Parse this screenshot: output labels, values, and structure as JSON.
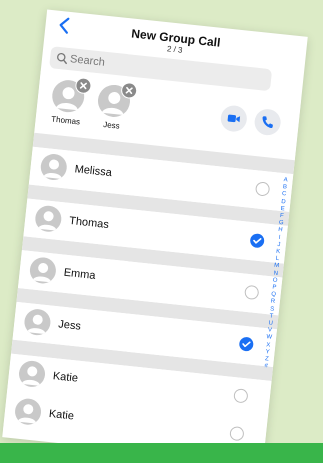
{
  "header": {
    "title": "New Group Call",
    "step": "2 / 3"
  },
  "search": {
    "placeholder": "Search"
  },
  "selected": [
    {
      "name": "Thomas"
    },
    {
      "name": "Jess"
    }
  ],
  "contacts": [
    {
      "name": "Melissa",
      "checked": false
    },
    {
      "name": "Thomas",
      "checked": true
    },
    {
      "name": "Emma",
      "checked": false
    },
    {
      "name": "Jess",
      "checked": true
    },
    {
      "name": "Katie",
      "checked": false
    },
    {
      "name": "Katie",
      "checked": false
    }
  ],
  "alphabet": [
    "A",
    "B",
    "C",
    "D",
    "E",
    "F",
    "G",
    "H",
    "I",
    "J",
    "K",
    "L",
    "M",
    "N",
    "O",
    "P",
    "Q",
    "R",
    "S",
    "T",
    "U",
    "V",
    "W",
    "X",
    "Y",
    "Z",
    "#"
  ],
  "colors": {
    "accent": "#1a6ff3",
    "background": "#dcebc6",
    "banner": "#39b54a"
  },
  "icons": {
    "back": "chevron-left-icon",
    "search": "search-icon",
    "remove": "close-icon",
    "video": "video-camera-icon",
    "phone": "phone-icon",
    "check": "checkmark-icon"
  }
}
